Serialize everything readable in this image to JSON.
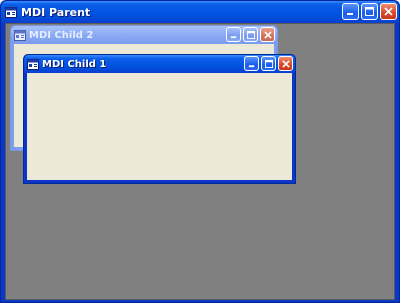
{
  "parent": {
    "title": "MDI Parent",
    "icon": "app-window-icon",
    "controls": [
      "minimize-icon",
      "maximize-icon",
      "close-icon"
    ]
  },
  "children": [
    {
      "title": "MDI Child 2",
      "active": false,
      "icon": "app-window-icon"
    },
    {
      "title": "MDI Child 1",
      "active": true,
      "icon": "app-window-icon"
    }
  ],
  "colors": {
    "active_title": "#0053e0",
    "inactive_title": "#8aaaf4",
    "client_bg": "#808080",
    "window_body": "#ece9d8",
    "close_button": "#d9472a"
  }
}
